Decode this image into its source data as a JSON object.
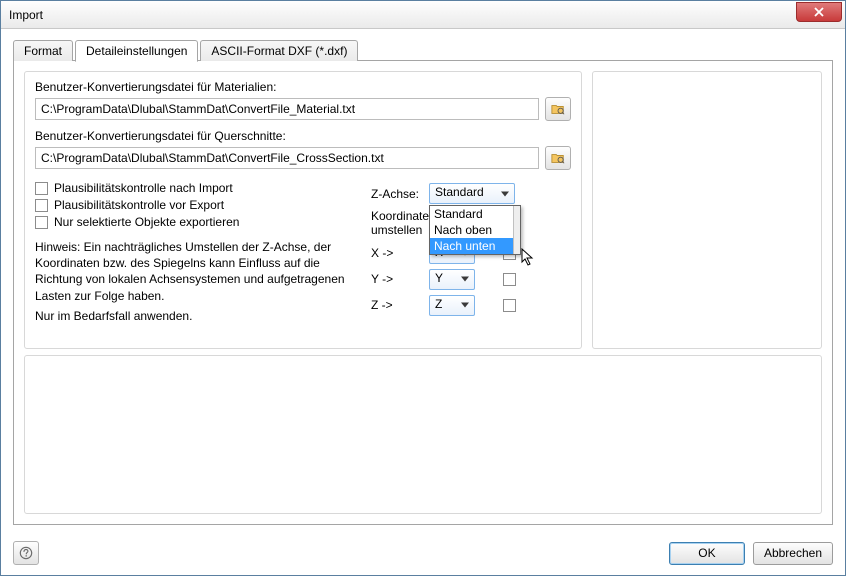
{
  "window": {
    "title": "Import"
  },
  "tabs": {
    "format": "Format",
    "details": "Detaileinstellungen",
    "ascii": "ASCII-Format DXF (*.dxf)"
  },
  "labels": {
    "material_label": "Benutzer-Konvertierungsdatei für Materialien:",
    "cross_label": "Benutzer-Konvertierungsdatei für Querschnitte:"
  },
  "paths": {
    "material": "C:\\ProgramData\\Dlubal\\StammDat\\ConvertFile_Material.txt",
    "crosssection": "C:\\ProgramData\\Dlubal\\StammDat\\ConvertFile_CrossSection.txt"
  },
  "checks": {
    "after_import": "Plausibilitätskontrolle nach Import",
    "before_export": "Plausibilitätskontrolle vor Export",
    "only_selected": "Nur selektierte Objekte exportieren"
  },
  "hint": {
    "line": "Hinweis: Ein nachträgliches Umstellen der Z-Achse, der Koordinaten bzw. des Spiegelns kann Einfluss auf die Richtung von lokalen Achsensystemen und aufgetragenen Lasten zur Folge haben.",
    "note": "Nur im Bedarfsfall anwenden."
  },
  "axis": {
    "z_label": "Z-Achse:",
    "z_value": "Standard",
    "koord_line1": "Koordinaten",
    "koord_line2": "umstellen",
    "x_label": "X ->",
    "y_label": "Y ->",
    "z2_label": "Z ->",
    "x_value": "X",
    "y_value": "Y",
    "z2_value": "Z",
    "options": {
      "o1": "Standard",
      "o2": "Nach oben",
      "o3": "Nach unten"
    }
  },
  "footer": {
    "ok": "OK",
    "cancel": "Abbrechen"
  }
}
